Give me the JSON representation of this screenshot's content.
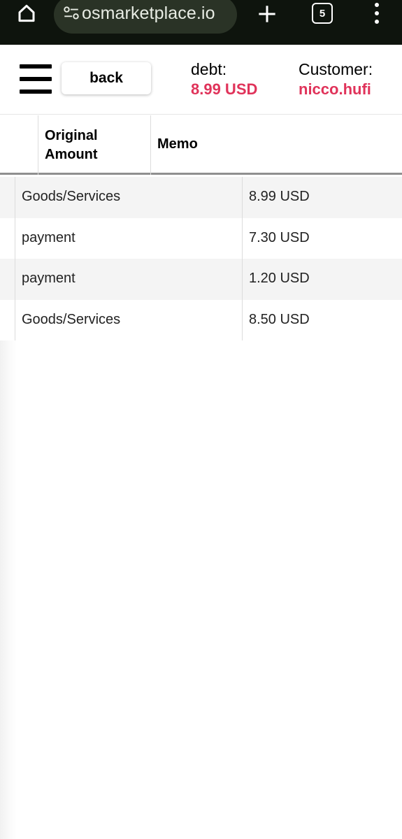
{
  "browser": {
    "url": "osmarketplace.io",
    "tab_count": "5"
  },
  "header": {
    "back_label": "back",
    "debt_label": "debt:",
    "debt_value": "8.99 USD",
    "customer_label": "Customer:",
    "customer_value": "nicco.hufi"
  },
  "table": {
    "columns": [
      "Original Amount",
      "Memo"
    ],
    "original_line1": "Original",
    "original_line2": "Amount",
    "memo": "Memo",
    "rows": [
      {
        "description": "Goods/Services",
        "amount": "8.99 USD"
      },
      {
        "description": "payment",
        "amount": "7.30 USD"
      },
      {
        "description": "payment",
        "amount": "1.20 USD"
      },
      {
        "description": "Goods/Services",
        "amount": "8.50 USD"
      }
    ]
  },
  "colors": {
    "accent": "#e0335a",
    "browser_bar": "#0e140d",
    "url_pill": "#2a3326"
  },
  "icons": [
    "home-icon",
    "site-settings-icon",
    "plus-icon",
    "tab-switcher-icon",
    "more-vert-icon",
    "hamburger-menu-icon"
  ]
}
